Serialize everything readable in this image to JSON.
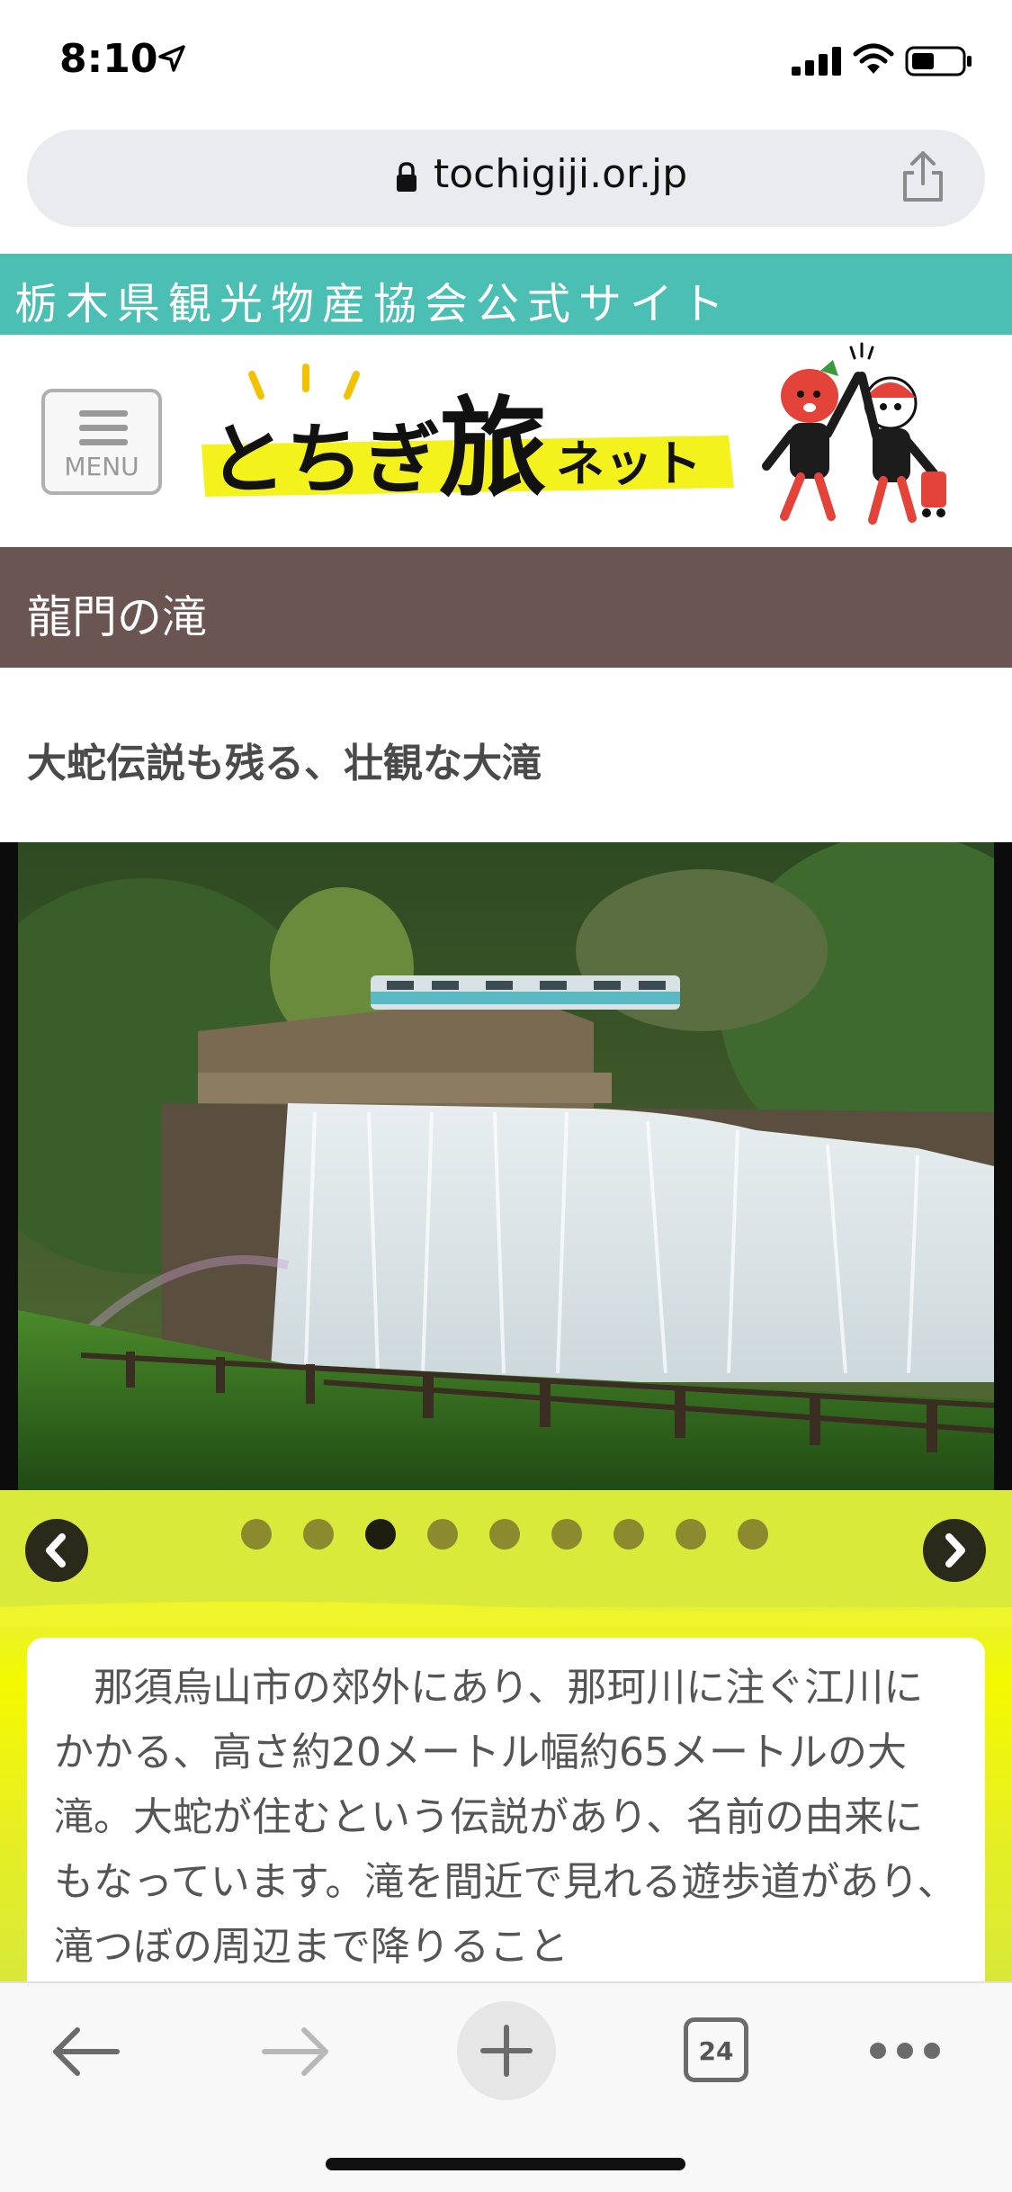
{
  "status_bar": {
    "time": "8:10"
  },
  "browser": {
    "url": "tochigiji.or.jp",
    "tab_count": "24"
  },
  "site": {
    "banner": "栃木県観光物産協会公式サイト",
    "menu_label": "MENU",
    "logo_text": "とちぎ旅ネット"
  },
  "page": {
    "title": "龍門の滝",
    "subtitle": "大蛇伝説も残る、壮観な大滝",
    "description": "那須烏山市の郊外にあり、那珂川に注ぐ江川にかかる、高さ約20メートル幅約65メートルの大滝。大蛇が住むという伝説があり、名前の由来にもなっています。滝を間近で見れる遊歩道があり、滝つぼの周辺まで降りること"
  },
  "carousel": {
    "slide_count": 9,
    "active_index": 2
  },
  "colors": {
    "banner": "#4bbfb3",
    "title_bar": "#6b5553",
    "carousel_bg": "#d9ea3a",
    "description_bg": "#f4f900"
  },
  "icons": [
    "location-arrow-icon",
    "signal-icon",
    "wifi-icon",
    "battery-icon",
    "lock-icon",
    "share-icon",
    "menu-icon",
    "prev-arrow-icon",
    "next-arrow-icon",
    "back-icon",
    "forward-icon",
    "plus-icon",
    "tabs-icon",
    "more-icon"
  ]
}
